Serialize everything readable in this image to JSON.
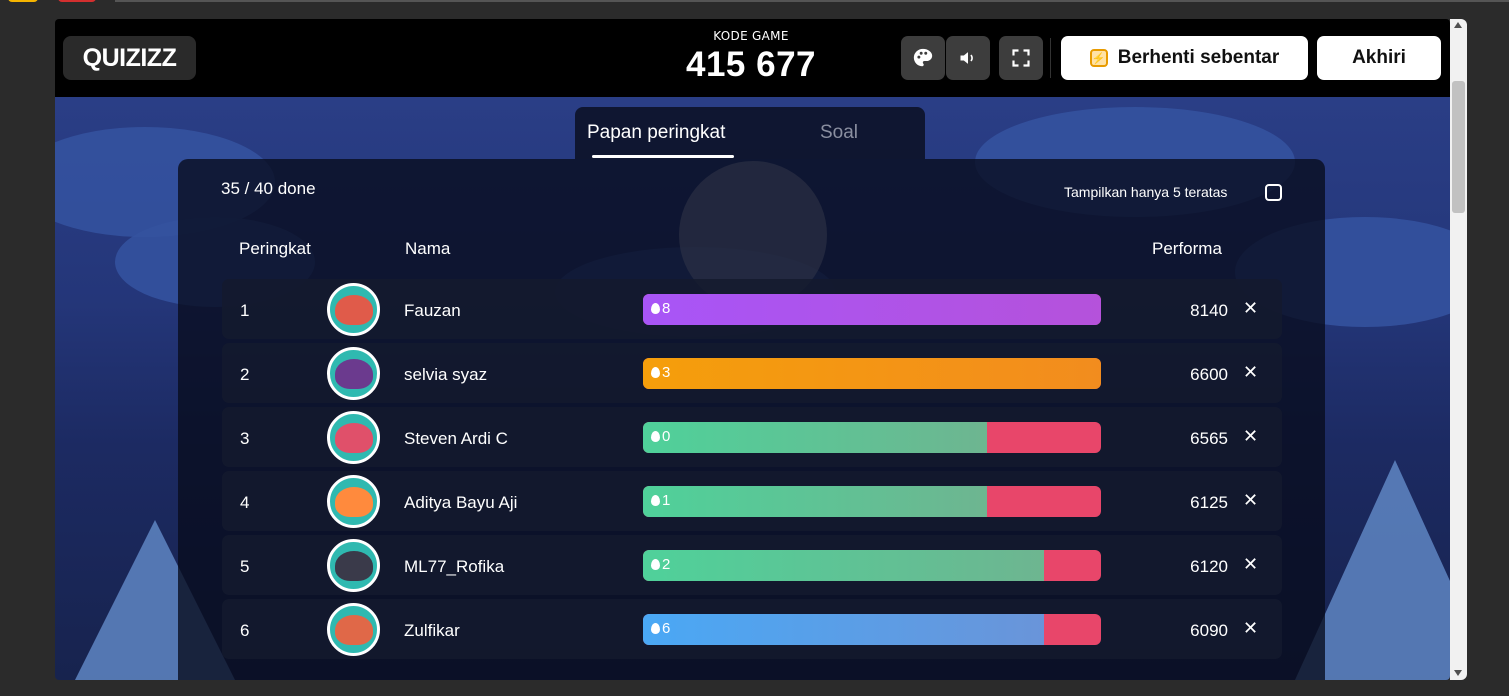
{
  "header": {
    "logo": "QUIZIZZ",
    "code_label": "KODE GAME",
    "code_value": "415 677",
    "pause_label": "Berhenti sebentar",
    "end_label": "Akhiri"
  },
  "tabs": [
    {
      "label": "Papan peringkat",
      "active": true
    },
    {
      "label": "Soal",
      "active": false
    }
  ],
  "panel": {
    "done": "35 / 40 done",
    "top5_label": "Tampilkan hanya 5 teratas",
    "columns": {
      "rank": "Peringkat",
      "name": "Nama",
      "performance": "Performa"
    }
  },
  "players": [
    {
      "rank": "1",
      "name": "Fauzan",
      "streak": "8",
      "score": "8140",
      "fill": 1.0,
      "fill_color": "#a855f7",
      "avatar_color": "#e05b4a"
    },
    {
      "rank": "2",
      "name": "selvia syaz",
      "streak": "3",
      "score": "6600",
      "fill": 1.0,
      "fill_color": "#f59e0b",
      "avatar_color": "#6b3a8e"
    },
    {
      "rank": "3",
      "name": "Steven Ardi C",
      "streak": "0",
      "score": "6565",
      "fill": 0.75,
      "fill_color": "#4fd19a",
      "avatar_color": "#e0506a"
    },
    {
      "rank": "4",
      "name": "Aditya Bayu Aji",
      "streak": "1",
      "score": "6125",
      "fill": 0.75,
      "fill_color": "#4fd19a",
      "avatar_color": "#ff8a3d"
    },
    {
      "rank": "5",
      "name": "ML77_Rofika",
      "streak": "2",
      "score": "6120",
      "fill": 0.875,
      "fill_color": "#4fd19a",
      "avatar_color": "#3a3a4a"
    },
    {
      "rank": "6",
      "name": "Zulfikar",
      "streak": "6",
      "score": "6090",
      "fill": 0.875,
      "fill_color": "#4aa8f5",
      "avatar_color": "#e06848"
    }
  ],
  "colors": {
    "correct": "#4fd19a",
    "incorrect": "#e8466a"
  },
  "icons": [
    "palette-icon",
    "volume-icon",
    "fullscreen-icon",
    "pause-icon",
    "flame-icon",
    "close-icon"
  ]
}
